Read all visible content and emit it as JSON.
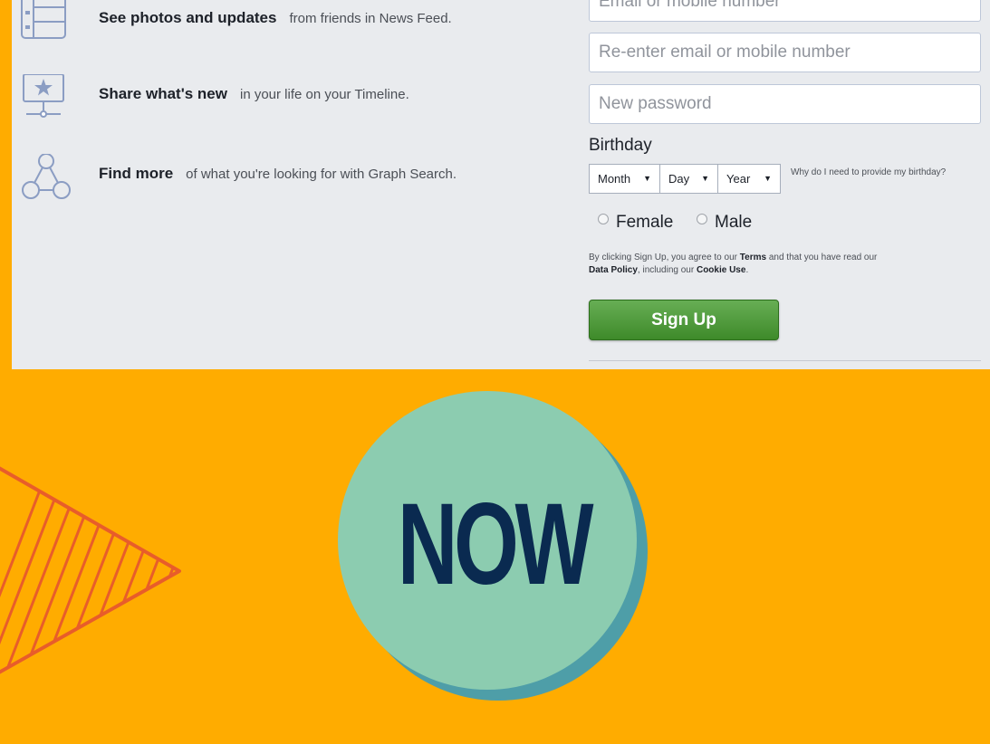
{
  "features": [
    {
      "icon": "news-feed-icon",
      "bold": "See photos and updates",
      "text": "from friends in News Feed."
    },
    {
      "icon": "timeline-icon",
      "bold": "Share what's new",
      "text": "in your life on your Timeline."
    },
    {
      "icon": "graph-search-icon",
      "bold": "Find more",
      "text": "of what you're looking for with Graph Search."
    }
  ],
  "form": {
    "email_placeholder": "Email or mobile number",
    "reenter_placeholder": "Re-enter email or mobile number",
    "password_placeholder": "New password",
    "birthday_label": "Birthday",
    "month": "Month",
    "day": "Day",
    "year": "Year",
    "why_text": "Why do I need to provide my birthday?",
    "female_label": "Female",
    "male_label": "Male",
    "terms_prefix": "By clicking Sign Up, you agree to our",
    "terms_link": "Terms",
    "terms_middle": "and that you have read our",
    "data_policy_link": "Data Policy",
    "terms_middle2": ", including our",
    "cookie_link": "Cookie Use",
    "terms_end": ".",
    "signup_label": "Sign Up"
  },
  "badge": {
    "text": "NOW"
  },
  "colors": {
    "background": "#FFAC00",
    "panel": "#E9EBEE",
    "signup_green": "#4A9A36",
    "badge_fill": "#8CCCB0",
    "badge_shadow": "#4E9EA8",
    "badge_text": "#0A2A50",
    "triangle_stroke": "#E85D2A"
  }
}
